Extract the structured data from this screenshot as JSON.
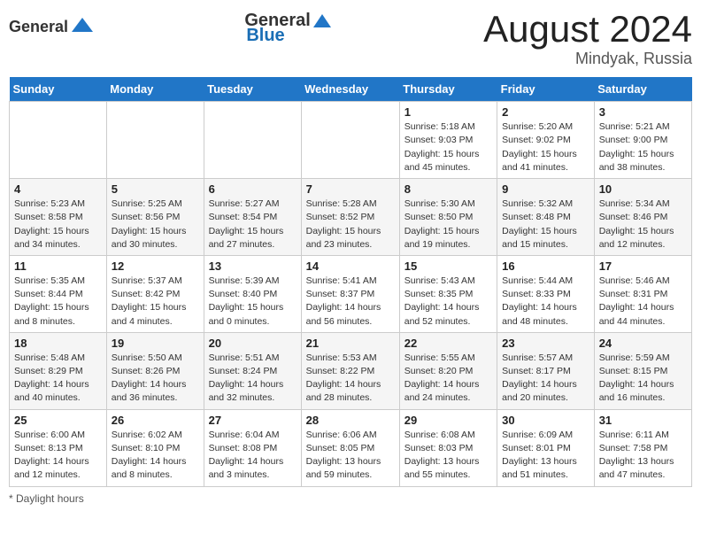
{
  "header": {
    "logo_general": "General",
    "logo_blue": "Blue",
    "month_title": "August 2024",
    "location": "Mindyak, Russia"
  },
  "days_of_week": [
    "Sunday",
    "Monday",
    "Tuesday",
    "Wednesday",
    "Thursday",
    "Friday",
    "Saturday"
  ],
  "footer": {
    "daylight_label": "Daylight hours"
  },
  "weeks": [
    [
      {
        "date": "",
        "info": ""
      },
      {
        "date": "",
        "info": ""
      },
      {
        "date": "",
        "info": ""
      },
      {
        "date": "",
        "info": ""
      },
      {
        "date": "1",
        "info": "Sunrise: 5:18 AM\nSunset: 9:03 PM\nDaylight: 15 hours\nand 45 minutes."
      },
      {
        "date": "2",
        "info": "Sunrise: 5:20 AM\nSunset: 9:02 PM\nDaylight: 15 hours\nand 41 minutes."
      },
      {
        "date": "3",
        "info": "Sunrise: 5:21 AM\nSunset: 9:00 PM\nDaylight: 15 hours\nand 38 minutes."
      }
    ],
    [
      {
        "date": "4",
        "info": "Sunrise: 5:23 AM\nSunset: 8:58 PM\nDaylight: 15 hours\nand 34 minutes."
      },
      {
        "date": "5",
        "info": "Sunrise: 5:25 AM\nSunset: 8:56 PM\nDaylight: 15 hours\nand 30 minutes."
      },
      {
        "date": "6",
        "info": "Sunrise: 5:27 AM\nSunset: 8:54 PM\nDaylight: 15 hours\nand 27 minutes."
      },
      {
        "date": "7",
        "info": "Sunrise: 5:28 AM\nSunset: 8:52 PM\nDaylight: 15 hours\nand 23 minutes."
      },
      {
        "date": "8",
        "info": "Sunrise: 5:30 AM\nSunset: 8:50 PM\nDaylight: 15 hours\nand 19 minutes."
      },
      {
        "date": "9",
        "info": "Sunrise: 5:32 AM\nSunset: 8:48 PM\nDaylight: 15 hours\nand 15 minutes."
      },
      {
        "date": "10",
        "info": "Sunrise: 5:34 AM\nSunset: 8:46 PM\nDaylight: 15 hours\nand 12 minutes."
      }
    ],
    [
      {
        "date": "11",
        "info": "Sunrise: 5:35 AM\nSunset: 8:44 PM\nDaylight: 15 hours\nand 8 minutes."
      },
      {
        "date": "12",
        "info": "Sunrise: 5:37 AM\nSunset: 8:42 PM\nDaylight: 15 hours\nand 4 minutes."
      },
      {
        "date": "13",
        "info": "Sunrise: 5:39 AM\nSunset: 8:40 PM\nDaylight: 15 hours\nand 0 minutes."
      },
      {
        "date": "14",
        "info": "Sunrise: 5:41 AM\nSunset: 8:37 PM\nDaylight: 14 hours\nand 56 minutes."
      },
      {
        "date": "15",
        "info": "Sunrise: 5:43 AM\nSunset: 8:35 PM\nDaylight: 14 hours\nand 52 minutes."
      },
      {
        "date": "16",
        "info": "Sunrise: 5:44 AM\nSunset: 8:33 PM\nDaylight: 14 hours\nand 48 minutes."
      },
      {
        "date": "17",
        "info": "Sunrise: 5:46 AM\nSunset: 8:31 PM\nDaylight: 14 hours\nand 44 minutes."
      }
    ],
    [
      {
        "date": "18",
        "info": "Sunrise: 5:48 AM\nSunset: 8:29 PM\nDaylight: 14 hours\nand 40 minutes."
      },
      {
        "date": "19",
        "info": "Sunrise: 5:50 AM\nSunset: 8:26 PM\nDaylight: 14 hours\nand 36 minutes."
      },
      {
        "date": "20",
        "info": "Sunrise: 5:51 AM\nSunset: 8:24 PM\nDaylight: 14 hours\nand 32 minutes."
      },
      {
        "date": "21",
        "info": "Sunrise: 5:53 AM\nSunset: 8:22 PM\nDaylight: 14 hours\nand 28 minutes."
      },
      {
        "date": "22",
        "info": "Sunrise: 5:55 AM\nSunset: 8:20 PM\nDaylight: 14 hours\nand 24 minutes."
      },
      {
        "date": "23",
        "info": "Sunrise: 5:57 AM\nSunset: 8:17 PM\nDaylight: 14 hours\nand 20 minutes."
      },
      {
        "date": "24",
        "info": "Sunrise: 5:59 AM\nSunset: 8:15 PM\nDaylight: 14 hours\nand 16 minutes."
      }
    ],
    [
      {
        "date": "25",
        "info": "Sunrise: 6:00 AM\nSunset: 8:13 PM\nDaylight: 14 hours\nand 12 minutes."
      },
      {
        "date": "26",
        "info": "Sunrise: 6:02 AM\nSunset: 8:10 PM\nDaylight: 14 hours\nand 8 minutes."
      },
      {
        "date": "27",
        "info": "Sunrise: 6:04 AM\nSunset: 8:08 PM\nDaylight: 14 hours\nand 3 minutes."
      },
      {
        "date": "28",
        "info": "Sunrise: 6:06 AM\nSunset: 8:05 PM\nDaylight: 13 hours\nand 59 minutes."
      },
      {
        "date": "29",
        "info": "Sunrise: 6:08 AM\nSunset: 8:03 PM\nDaylight: 13 hours\nand 55 minutes."
      },
      {
        "date": "30",
        "info": "Sunrise: 6:09 AM\nSunset: 8:01 PM\nDaylight: 13 hours\nand 51 minutes."
      },
      {
        "date": "31",
        "info": "Sunrise: 6:11 AM\nSunset: 7:58 PM\nDaylight: 13 hours\nand 47 minutes."
      }
    ]
  ]
}
